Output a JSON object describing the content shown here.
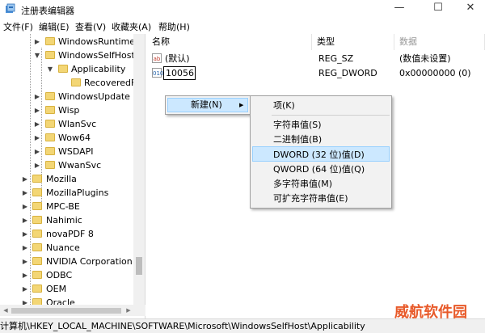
{
  "window": {
    "title": "注册表编辑器",
    "controls": {
      "minimize": "—",
      "maximize": "☐",
      "close": "✕"
    }
  },
  "menu": [
    "文件(F)",
    "编辑(E)",
    "查看(V)",
    "收藏夹(A)",
    "帮助(H)"
  ],
  "tree": [
    {
      "label": "WindowsRuntime",
      "expander": "▶"
    },
    {
      "label": "WindowsSelfHost",
      "expander": "▼"
    },
    {
      "label": "Applicability",
      "expander": "▼"
    },
    {
      "label": "RecoveredFr",
      "expander": ""
    },
    {
      "label": "WindowsUpdate",
      "expander": "▶"
    },
    {
      "label": "Wisp",
      "expander": "▶"
    },
    {
      "label": "WlanSvc",
      "expander": "▶"
    },
    {
      "label": "Wow64",
      "expander": "▶"
    },
    {
      "label": "WSDAPI",
      "expander": "▶"
    },
    {
      "label": "WwanSvc",
      "expander": "▶"
    },
    {
      "label": "Mozilla",
      "expander": "▶"
    },
    {
      "label": "MozillaPlugins",
      "expander": "▶"
    },
    {
      "label": "MPC-BE",
      "expander": "▶"
    },
    {
      "label": "Nahimic",
      "expander": "▶"
    },
    {
      "label": "novaPDF 8",
      "expander": "▶"
    },
    {
      "label": "Nuance",
      "expander": "▶"
    },
    {
      "label": "NVIDIA Corporation",
      "expander": "▶"
    },
    {
      "label": "ODBC",
      "expander": "▶"
    },
    {
      "label": "OEM",
      "expander": "▶"
    },
    {
      "label": "Oracle",
      "expander": "▶"
    }
  ],
  "columns": {
    "name": "名称",
    "type": "类型",
    "data": "数据"
  },
  "values": [
    {
      "icon": "ab",
      "name": "(默认)",
      "type": "REG_SZ",
      "data": "(数值未设置)"
    },
    {
      "icon": "010",
      "name": "10056",
      "type": "REG_DWORD",
      "data": "0x00000000 (0)"
    }
  ],
  "context_menu": {
    "new_label": "新建(N)",
    "submenu_arrow": "▶",
    "items": [
      "项(K)",
      "字符串值(S)",
      "二进制值(B)",
      "DWORD (32 位)值(D)",
      "QWORD (64 位)值(Q)",
      "多字符串值(M)",
      "可扩充字符串值(E)"
    ]
  },
  "status_path": "计算机\\HKEY_LOCAL_MACHINE\\SOFTWARE\\Microsoft\\WindowsSelfHost\\Applicability",
  "watermark": "威航软件园",
  "colors": {
    "highlight": "#cce8ff",
    "folder": "#f3d675",
    "watermark": "#e85a2a"
  }
}
